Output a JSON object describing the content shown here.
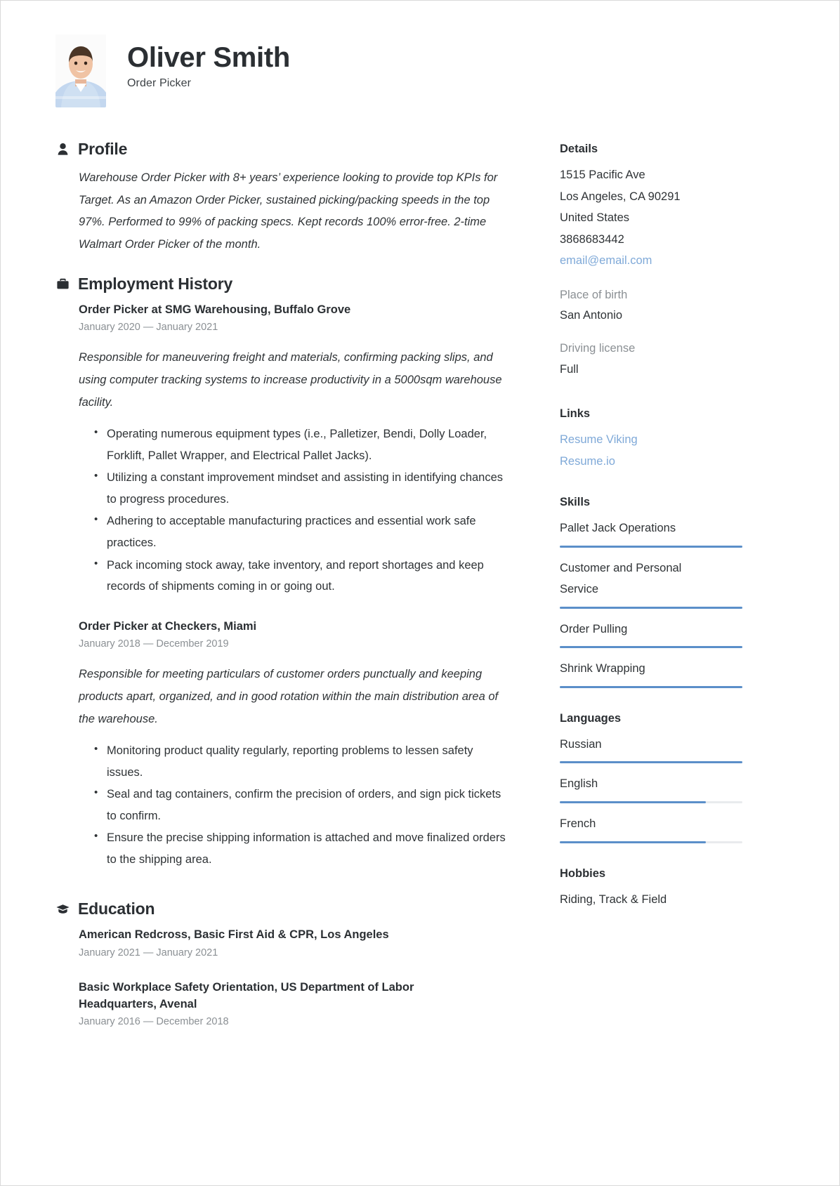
{
  "header": {
    "name": "Oliver Smith",
    "job_title": "Order Picker",
    "avatar_alt": "portrait-photo"
  },
  "profile": {
    "heading": "Profile",
    "icon": "person-icon",
    "text": "Warehouse Order Picker with 8+ years’ experience looking to provide top KPIs for Target. As an Amazon Order Picker, sustained picking/packing speeds in the top 97%. Performed to 99% of packing specs. Kept records 100% error-free. 2-time Walmart Order Picker of the month."
  },
  "employment": {
    "heading": "Employment History",
    "icon": "briefcase-icon",
    "entries": [
      {
        "title": "Order Picker at SMG Warehousing, Buffalo Grove",
        "dates": "January 2020 — January 2021",
        "description": "Responsible for maneuvering freight and materials, confirming packing slips, and using computer tracking systems to increase productivity in a 5000sqm warehouse facility.",
        "bullets": [
          "Operating numerous equipment types (i.e., Palletizer, Bendi, Dolly Loader, Forklift, Pallet Wrapper, and Electrical Pallet Jacks).",
          "Utilizing a constant improvement mindset and assisting in identifying chances to progress procedures.",
          "Adhering to acceptable manufacturing practices and essential work safe practices.",
          "Pack incoming stock away, take inventory, and report shortages and keep records of shipments coming in or going out."
        ]
      },
      {
        "title": "Order Picker at Checkers, Miami",
        "dates": "January 2018 — December 2019",
        "description": "Responsible for meeting particulars of customer orders punctually and keeping products apart, organized, and in good rotation within the main distribution area of the warehouse.",
        "bullets": [
          "Monitoring product quality regularly, reporting problems to lessen safety issues.",
          "Seal and tag containers, confirm the precision of orders, and sign pick tickets to confirm.",
          "Ensure the precise shipping information is attached and move finalized orders to the shipping area."
        ]
      }
    ]
  },
  "education": {
    "heading": "Education",
    "icon": "graduation-cap-icon",
    "entries": [
      {
        "title": "American Redcross, Basic First Aid & CPR, Los Angeles",
        "dates": "January 2021 — January 2021"
      },
      {
        "title": "Basic Workplace Safety Orientation, US Department of Labor Headquarters, Avenal",
        "dates": "January 2016 — December 2018"
      }
    ]
  },
  "details": {
    "heading": "Details",
    "address_line1": "1515 Pacific Ave",
    "address_line2": "Los Angeles, CA 90291",
    "country": "United States",
    "phone": "3868683442",
    "email": "email@email.com",
    "place_of_birth_label": "Place of birth",
    "place_of_birth": "San Antonio",
    "driving_license_label": "Driving license",
    "driving_license": "Full"
  },
  "links": {
    "heading": "Links",
    "items": [
      {
        "label": "Resume Viking"
      },
      {
        "label": "Resume.io"
      }
    ]
  },
  "skills": {
    "heading": "Skills",
    "items": [
      {
        "label": "Pallet Jack Operations",
        "level": 100
      },
      {
        "label": "Customer and Personal Service",
        "level": 100
      },
      {
        "label": "Order Pulling",
        "level": 100
      },
      {
        "label": "Shrink Wrapping",
        "level": 100
      }
    ]
  },
  "languages": {
    "heading": "Languages",
    "items": [
      {
        "label": "Russian",
        "level": 100
      },
      {
        "label": "English",
        "level": 80
      },
      {
        "label": "French",
        "level": 80
      }
    ]
  },
  "hobbies": {
    "heading": "Hobbies",
    "text": "Riding, Track & Field"
  },
  "colors": {
    "accent": "#5b8fc9",
    "link": "#7fa9d8",
    "text": "#2f3336",
    "muted": "#8b9094"
  }
}
